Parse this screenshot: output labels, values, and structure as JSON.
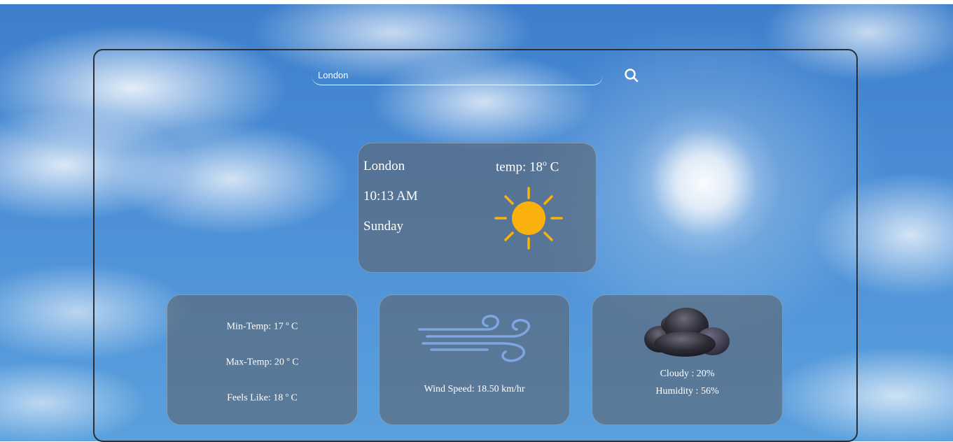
{
  "search": {
    "value": "London"
  },
  "current": {
    "city": "London",
    "time": "10:13 AM",
    "day": "Sunday",
    "temp_label": "temp: ",
    "temp_value": "18",
    "deg_mark": "o",
    "temp_unit": " C",
    "icon": "sun-icon"
  },
  "temps": {
    "min_label": "Min-Temp: ",
    "min_value": "17",
    "max_label": "Max-Temp: ",
    "max_value": "20",
    "feels_label": "Feels Like: ",
    "feels_value": "18",
    "deg_mark": "o",
    "unit": " C"
  },
  "wind": {
    "label": "Wind Speed: ",
    "value": "18.50 km/hr",
    "icon": "wind-icon"
  },
  "clouds": {
    "cloudy_label": "Cloudy : ",
    "cloudy_value": "20%",
    "humidity_label": "Humidity : ",
    "humidity_value": "56%",
    "icon": "dark-cloud-icon"
  },
  "colors": {
    "sun": "#fbb10d",
    "wind": "#7ea6e0",
    "card": "#5c6470"
  }
}
